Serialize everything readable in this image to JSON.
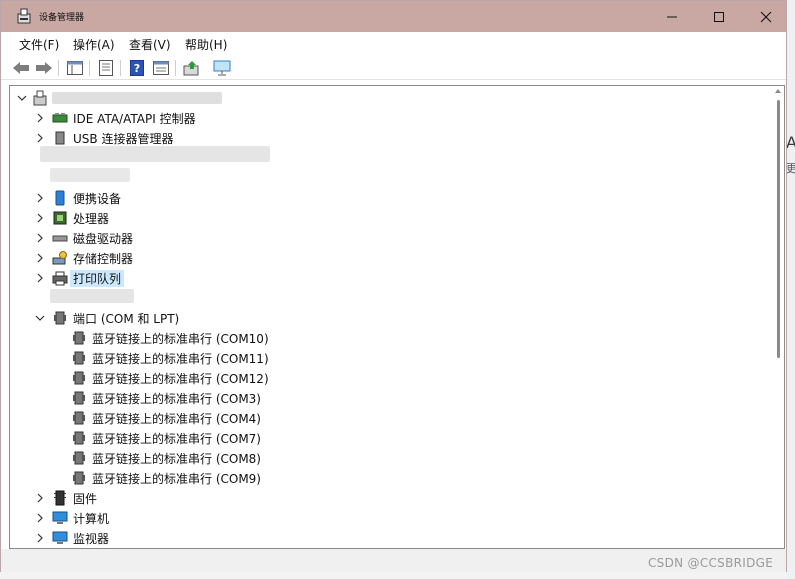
{
  "window": {
    "title": "设备管理器"
  },
  "menu": [
    {
      "label": "文件(F)"
    },
    {
      "label": "操作(A)"
    },
    {
      "label": "查看(V)"
    },
    {
      "label": "帮助(H)"
    }
  ],
  "toolbar": {
    "buttons": [
      "back-icon",
      "forward-icon",
      "properties-icon",
      "driver-icon",
      "help-icon",
      "view-icon",
      "update-driver-icon",
      "scan-hardware-icon"
    ]
  },
  "tree": {
    "items": [
      {
        "label": "IDE ATA/ATAPI 控制器",
        "icon": "ide-controller-icon",
        "expanded": false
      },
      {
        "label": "USB 连接器管理器",
        "icon": "usb-connector-icon",
        "expanded": false
      },
      {
        "label": "便携设备",
        "icon": "portable-device-icon",
        "expanded": false
      },
      {
        "label": "处理器",
        "icon": "processor-icon",
        "expanded": false
      },
      {
        "label": "磁盘驱动器",
        "icon": "disk-drive-icon",
        "expanded": false
      },
      {
        "label": "存储控制器",
        "icon": "storage-controller-icon",
        "expanded": false
      },
      {
        "label": "打印队列",
        "icon": "print-queue-icon",
        "expanded": false,
        "selected": true
      },
      {
        "label": "端口 (COM 和 LPT)",
        "icon": "port-icon",
        "expanded": true
      },
      {
        "label": "固件",
        "icon": "firmware-icon",
        "expanded": false
      },
      {
        "label": "计算机",
        "icon": "computer-icon",
        "expanded": false
      },
      {
        "label": "监视器",
        "icon": "monitor-icon",
        "expanded": false
      }
    ],
    "ports": [
      {
        "label": "蓝牙链接上的标准串行 (COM10)"
      },
      {
        "label": "蓝牙链接上的标准串行 (COM11)"
      },
      {
        "label": "蓝牙链接上的标准串行 (COM12)"
      },
      {
        "label": "蓝牙链接上的标准串行 (COM3)"
      },
      {
        "label": "蓝牙链接上的标准串行 (COM4)"
      },
      {
        "label": "蓝牙链接上的标准串行 (COM7)"
      },
      {
        "label": "蓝牙链接上的标准串行 (COM8)"
      },
      {
        "label": "蓝牙链接上的标准串行 (COM9)"
      }
    ]
  },
  "watermark": "CSDN @CCSBRIDGE",
  "side_text": {
    "a": "A",
    "b": "更"
  },
  "colors": {
    "titlebar": "#c9a7a3",
    "selection": "#cce8ff",
    "border": "#8a8a8a"
  }
}
